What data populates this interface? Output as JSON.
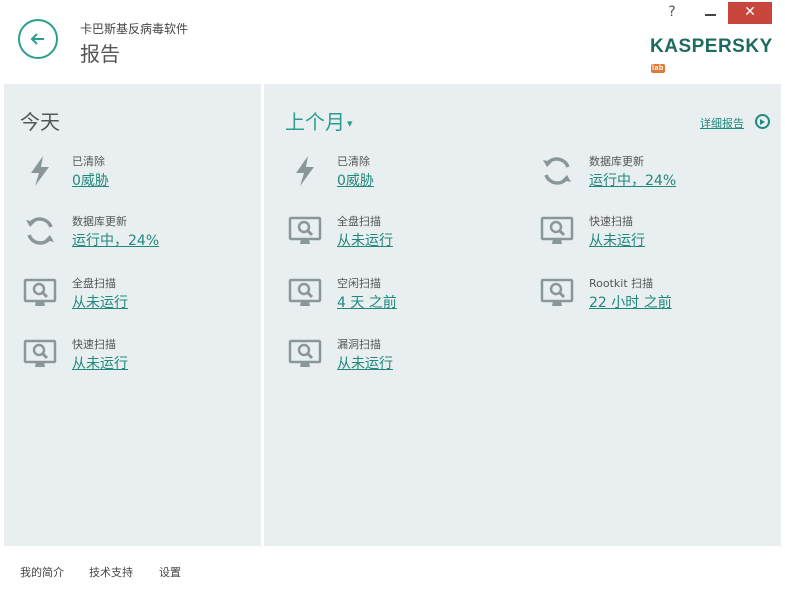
{
  "header": {
    "app_name": "卡巴斯基反病毒软件",
    "page_title": "报告",
    "help": "?",
    "close": "✕",
    "logo": "KASPERSKY",
    "logo_badge": "lab"
  },
  "today": {
    "heading": "今天",
    "items": [
      {
        "label": "已清除",
        "value": "0威胁",
        "icon": "lightning-icon"
      },
      {
        "label": "数据库更新",
        "value": "运行中，24%",
        "icon": "refresh-icon"
      },
      {
        "label": "全盘扫描",
        "value": "从未运行",
        "icon": "monitor-scan-icon"
      },
      {
        "label": "快速扫描",
        "value": "从未运行",
        "icon": "monitor-scan-icon"
      }
    ]
  },
  "month": {
    "heading": "上个月",
    "detail_link": "详细报告",
    "col1": [
      {
        "label": "已清除",
        "value": "0威胁",
        "icon": "lightning-icon"
      },
      {
        "label": "全盘扫描",
        "value": "从未运行",
        "icon": "monitor-scan-icon"
      },
      {
        "label": "空闲扫描",
        "value": "4 天 之前",
        "icon": "monitor-scan-icon"
      },
      {
        "label": "漏洞扫描",
        "value": "从未运行",
        "icon": "monitor-scan-icon"
      }
    ],
    "col2": [
      {
        "label": "数据库更新",
        "value": "运行中，24%",
        "icon": "refresh-icon"
      },
      {
        "label": "快速扫描",
        "value": "从未运行",
        "icon": "monitor-scan-icon"
      },
      {
        "label": "Rootkit 扫描",
        "value": "22 小时 之前",
        "icon": "monitor-scan-icon"
      }
    ]
  },
  "footer": {
    "links": [
      "我的简介",
      "技术支持",
      "设置"
    ]
  },
  "colors": {
    "accent": "#2b9e8f",
    "link": "#1f8a7c",
    "panel": "#e9eff0",
    "close": "#c9463d"
  }
}
